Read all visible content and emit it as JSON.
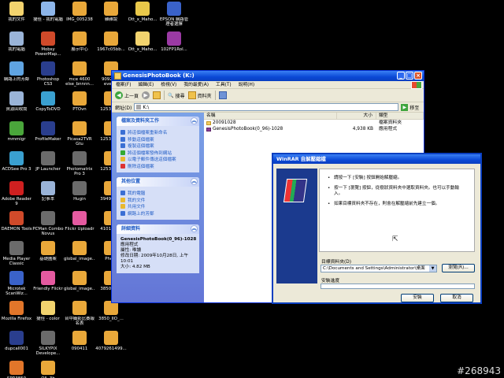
{
  "desktop": {
    "icons": [
      {
        "label": "我的文件",
        "color": "#f2d36e"
      },
      {
        "label": "捷徑 - 我的電腦",
        "color": "#8db6ea"
      },
      {
        "label": "IMG_005238",
        "color": "#e9a83a"
      },
      {
        "label": "雜雜說",
        "color": "#e9a83a"
      },
      {
        "label": "Ott_x_Maho...",
        "color": "#e9c84a"
      },
      {
        "label": "EPSON 網路管理者選擇",
        "color": "#3a62c9"
      },
      {
        "label": "我的電腦",
        "color": "#9ab4d8"
      },
      {
        "label": "Mobsy PowerMap...",
        "color": "#d04a2a"
      },
      {
        "label": "展示中心",
        "color": "#e9a83a"
      },
      {
        "label": "1967c05bb...",
        "color": "#e9a83a"
      },
      {
        "label": "Ott_x_Maho...",
        "color": "#f2d36e"
      },
      {
        "label": "102FP1Rol...",
        "color": "#9b3aa4"
      },
      {
        "label": "網路上的芳鄰",
        "color": "#5fa4e2"
      },
      {
        "label": "Photoshop CS3",
        "color": "#2a3e8e"
      },
      {
        "label": "mce 4600 else_bnnnn...",
        "color": "#e9a83a"
      },
      {
        "label": "90923 m events",
        "color": "#e9a83a"
      },
      {
        "label": "資源回收筒",
        "color": "#9ab4d8"
      },
      {
        "label": "CopyToDVD",
        "color": "#3aa0d0"
      },
      {
        "label": "PTOvn",
        "color": "#e9a83a"
      },
      {
        "label": "12538595",
        "color": "#e9a83a"
      },
      {
        "label": "mmmigr",
        "color": "#4aa63b"
      },
      {
        "label": "ProfileMaker",
        "color": "#2a3e8e"
      },
      {
        "label": "Picasa2TVR Gtu",
        "color": "#e9a83a"
      },
      {
        "label": "12538599",
        "color": "#e9a83a"
      },
      {
        "label": "ACDSee Pro 3",
        "color": "#3aa0d0"
      },
      {
        "label": "JP Launcher",
        "color": "#6b6b6b"
      },
      {
        "label": "Photomatrix Pro 3",
        "color": "#6b6b6b"
      },
      {
        "label": "12530502",
        "color": "#e9a83a"
      },
      {
        "label": "Adobe Reader 9",
        "color": "#cf2020"
      },
      {
        "label": "記事本",
        "color": "#9ab4d8"
      },
      {
        "label": "Hugin",
        "color": "#6b6b6b"
      },
      {
        "label": "39497274",
        "color": "#e9a83a"
      },
      {
        "label": "DAEMON Tools",
        "color": "#d04a2a"
      },
      {
        "label": "PCMan Combo Novus",
        "color": "#6b6b6b"
      },
      {
        "label": "Flickr Uploadr",
        "color": "#e45aa0"
      },
      {
        "label": "41017737",
        "color": "#e9a83a"
      },
      {
        "label": "Media Player Classic",
        "color": "#6b6b6b"
      },
      {
        "label": "基礎圖案",
        "color": "#e9a83a"
      },
      {
        "label": "global_image...",
        "color": "#e9a83a"
      },
      {
        "label": "Photo",
        "color": "#e9a83a"
      },
      {
        "label": "Microtek ScanWiz...",
        "color": "#3a62c9"
      },
      {
        "label": "Friendly Flickr",
        "color": "#e45aa0"
      },
      {
        "label": "global_image...",
        "color": "#e9a83a"
      },
      {
        "label": "3850_IO...",
        "color": "#e9a83a"
      },
      {
        "label": "Mozilla Firefox",
        "color": "#e2762a"
      },
      {
        "label": "捷徑 - color",
        "color": "#f2d36e"
      },
      {
        "label": "台中攝影比賽報名表",
        "color": "#e9a83a"
      },
      {
        "label": "3850_IIO_...",
        "color": "#e9a83a"
      },
      {
        "label": "dupcall001",
        "color": "#2a3e8e"
      },
      {
        "label": "SILKYPIX Develope...",
        "color": "#6b6b6b"
      },
      {
        "label": "090411",
        "color": "#e9a83a"
      },
      {
        "label": "4079261499...",
        "color": "#e9a83a"
      },
      {
        "label": "SPR3850 PASenaPho...",
        "color": "#e2762a"
      },
      {
        "label": "OIL-3b",
        "color": "#e9a83a"
      }
    ],
    "watermark": "#268943"
  },
  "explorer": {
    "title": "GenesisPhotoBook (K:)",
    "menu": [
      "檔案(F)",
      "編輯(E)",
      "檢視(V)",
      "我的最愛(A)",
      "工具(T)",
      "說明(H)"
    ],
    "toolbar": {
      "back": "上一頁",
      "search": "搜尋",
      "folders": "資料夾"
    },
    "address_label": "網址(D)",
    "address_value": "K:\\",
    "go_label": "移至",
    "tasks_header": "檔案及資料夾工作",
    "tasks": [
      "將這個檔案重新命名",
      "移動這個檔案",
      "複製這個檔案",
      "將這個檔案發佈到網站",
      "以電子郵件傳送這個檔案",
      "刪除這個檔案"
    ],
    "places_header": "其他位置",
    "places": [
      "我的電腦",
      "我的文件",
      "共用文件",
      "網路上的芳鄰"
    ],
    "details_header": "詳細資料",
    "details": {
      "name": "GenesisPhotoBook(0_96)-1028",
      "type": "應用程式",
      "attr": "屬性: 唯讀",
      "modified": "修改日期: 2009年10月28日, 上午 10:01",
      "size": "大小: 4.82 MB"
    },
    "columns": {
      "name": "名稱",
      "size": "大小",
      "type": "類型"
    },
    "files": [
      {
        "name": "20091028",
        "size": "",
        "type": "檔案資料夾",
        "icon": "folder-icon"
      },
      {
        "name": "GenesisPhotoBook(0_96)-1028",
        "size": "4,938 KB",
        "type": "應用程式",
        "icon": "winrar-icon"
      }
    ]
  },
  "winrar": {
    "title": "WinRAR 自解壓縮檔",
    "lines": [
      "請按一下 [安裝] 按鈕開始解壓縮。",
      "按一下 [瀏覽] 按鈕，從樹狀資料夾中選取資料夾。也可以手動輸入。",
      "如果目標資料夾不存在，則會在解壓縮前先建立一個。"
    ],
    "dest_label": "目標資料夾(D)",
    "dest_value": "C:\\Documents and Settings\\Administrator\\桌面",
    "browse": "瀏覽(R)...",
    "progress_label": "安裝進度",
    "progress": 0,
    "install": "安裝",
    "cancel": "取消"
  }
}
